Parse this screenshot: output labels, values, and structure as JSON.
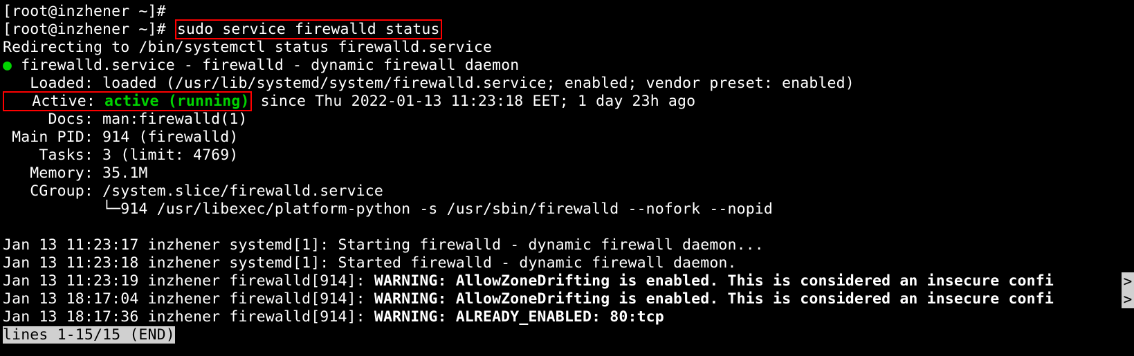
{
  "prompt": "[root@inzhener ~]#",
  "cmd": "sudo service firewalld status",
  "redirect": "Redirecting to /bin/systemctl status firewalld.service",
  "unit_line": " firewalld.service - firewalld - dynamic firewall daemon",
  "loaded": "   Loaded: loaded (/usr/lib/systemd/system/firewalld.service; enabled; vendor preset: enabled)",
  "active_label": "   Active: ",
  "active_status": "active (running)",
  "active_rest": " since Thu 2022-01-13 11:23:18 EET; 1 day 23h ago",
  "docs": "     Docs: man:firewalld(1)",
  "mainpid": " Main PID: 914 (firewalld)",
  "tasks": "    Tasks: 3 (limit: 4769)",
  "memory": "   Memory: 35.1M",
  "cgroup": "   CGroup: /system.slice/firewalld.service",
  "cgroup_child": "           └─914 /usr/libexec/platform-python -s /usr/sbin/firewalld --nofork --nopid",
  "log1": "Jan 13 11:23:17 inzhener systemd[1]: Starting firewalld - dynamic firewall daemon...",
  "log2": "Jan 13 11:23:18 inzhener systemd[1]: Started firewalld - dynamic firewall daemon.",
  "log3a": "Jan 13 11:23:19 inzhener firewalld[914]: ",
  "log3b": "WARNING: AllowZoneDrifting is enabled. This is considered an insecure confi",
  "log4a": "Jan 13 18:17:04 inzhener firewalld[914]: ",
  "log4b": "WARNING: AllowZoneDrifting is enabled. This is considered an insecure confi",
  "log5a": "Jan 13 18:17:36 inzhener firewalld[914]: ",
  "log5b": "WARNING: ALREADY_ENABLED: 80:tcp",
  "pager": "lines 1-15/15 (END)",
  "scrollglyph": ">"
}
